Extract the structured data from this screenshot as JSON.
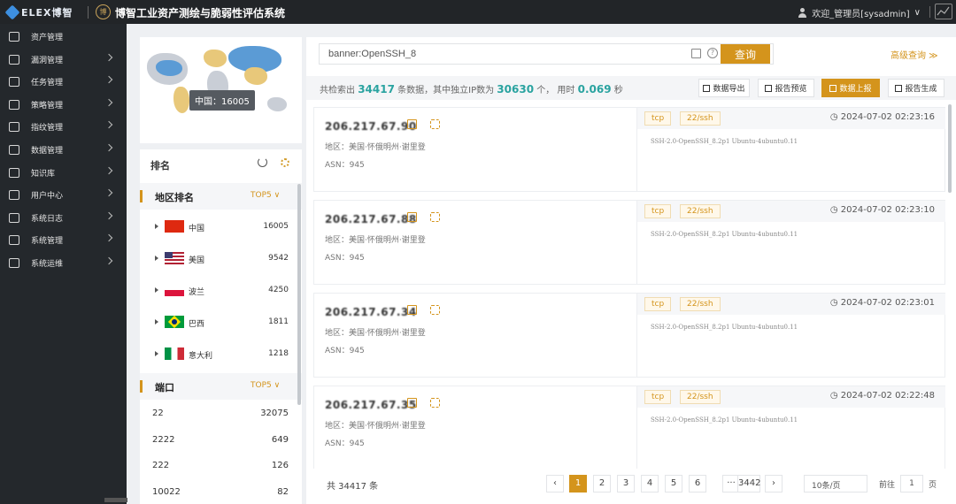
{
  "header": {
    "brand": "ELEX博智",
    "seal": "博",
    "title": "博智工业资产测绘与脆弱性评估系统",
    "user_label": "欢迎_管理员[sysadmin]",
    "dropdown_caret": "∨"
  },
  "sidebar": {
    "items": [
      {
        "label": "资产管理",
        "icon": "database-icon",
        "chevron": false
      },
      {
        "label": "漏洞管理",
        "icon": "bug-icon",
        "chevron": true
      },
      {
        "label": "任务管理",
        "icon": "clipboard-icon",
        "chevron": true
      },
      {
        "label": "策略管理",
        "icon": "policy-icon",
        "chevron": true
      },
      {
        "label": "指纹管理",
        "icon": "layers-icon",
        "chevron": true
      },
      {
        "label": "数据管理",
        "icon": "data-icon",
        "chevron": true
      },
      {
        "label": "知识库",
        "icon": "book-icon",
        "chevron": true
      },
      {
        "label": "用户中心",
        "icon": "user-icon",
        "chevron": true
      },
      {
        "label": "系统日志",
        "icon": "log-icon",
        "chevron": true
      },
      {
        "label": "系统管理",
        "icon": "gear-icon",
        "chevron": true
      },
      {
        "label": "系统运维",
        "icon": "toolbox-icon",
        "chevron": true
      }
    ]
  },
  "map": {
    "tooltip": "中国：16005"
  },
  "ranking": {
    "title": "排名",
    "region": {
      "title": "地区排名",
      "top": "TOP5",
      "caret": "∨",
      "items": [
        {
          "name": "中国",
          "count": "16005",
          "flag": "cn"
        },
        {
          "name": "美国",
          "count": "9542",
          "flag": "us"
        },
        {
          "name": "波兰",
          "count": "4250",
          "flag": "pl"
        },
        {
          "name": "巴西",
          "count": "1811",
          "flag": "br"
        },
        {
          "name": "意大利",
          "count": "1218",
          "flag": "it"
        }
      ]
    },
    "port": {
      "title": "端口",
      "top": "TOP5",
      "caret": "∨",
      "items": [
        {
          "name": "22",
          "count": "32075"
        },
        {
          "name": "2222",
          "count": "649"
        },
        {
          "name": "222",
          "count": "126"
        },
        {
          "name": "10022",
          "count": "82"
        }
      ]
    }
  },
  "search": {
    "value": "banner:OpenSSH_8",
    "help": "?",
    "button": "查询",
    "advanced": "高级查询 ≫"
  },
  "stats": {
    "prefix": "共检索出",
    "total": "34417",
    "mid": "条数据，其中独立IP数为",
    "unique_ip": "30630",
    "unit": "个，",
    "time_label": "用时",
    "time": "0.069",
    "time_unit": "秒"
  },
  "toolbar": {
    "export": "数据导出",
    "preview": "报告预览",
    "upload": "数据上报",
    "generate": "报告生成"
  },
  "results": [
    {
      "ip": "206.217.67.90",
      "region": "地区：美国·怀俄明州·谢里登",
      "asn": "ASN：945",
      "proto": "tcp",
      "port": "22/ssh",
      "time": "2024-07-02 02:23:16",
      "banner": "SSH-2.0-OpenSSH_8.2p1 Ubuntu-4ubuntu0.11"
    },
    {
      "ip": "206.217.67.88",
      "region": "地区：美国·怀俄明州·谢里登",
      "asn": "ASN：945",
      "proto": "tcp",
      "port": "22/ssh",
      "time": "2024-07-02 02:23:10",
      "banner": "SSH-2.0-OpenSSH_8.2p1 Ubuntu-4ubuntu0.11"
    },
    {
      "ip": "206.217.67.34",
      "region": "地区：美国·怀俄明州·谢里登",
      "asn": "ASN：945",
      "proto": "tcp",
      "port": "22/ssh",
      "time": "2024-07-02 02:23:01",
      "banner": "SSH-2.0-OpenSSH_8.2p1 Ubuntu-4ubuntu0.11"
    },
    {
      "ip": "206.217.67.35",
      "region": "地区：美国·怀俄明州·谢里登",
      "asn": "ASN：945",
      "proto": "tcp",
      "port": "22/ssh",
      "time": "2024-07-02 02:22:48",
      "banner": "SSH-2.0-OpenSSH_8.2p1 Ubuntu-4ubuntu0.11"
    }
  ],
  "pagination": {
    "total": "共 34417 条",
    "prev": "‹",
    "pages": [
      "1",
      "2",
      "3",
      "4",
      "5",
      "6"
    ],
    "ellipsis": "···",
    "last": "3442",
    "next": "›",
    "page_size": "10条/页",
    "goto": "前往",
    "goto_value": "1",
    "page_suffix": "页"
  },
  "colors": {
    "accent": "#d4941c",
    "highlight": "#2aa3a0",
    "sidebar": "#24282c",
    "header": "#222528"
  }
}
